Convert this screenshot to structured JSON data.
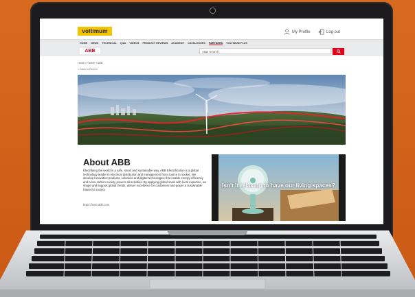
{
  "header": {
    "logo_text": "voltimum",
    "profile_label": "My Profile",
    "logout_label": "Log out"
  },
  "nav": {
    "items": [
      "HOME",
      "NEWS",
      "TECHNICAL",
      "Q&A",
      "VIDEOS",
      "PRODUCT REVIEWS",
      "ACADEMY",
      "CATALOGUES",
      "PARTNERS",
      "VOLTIMUM PLUS"
    ],
    "active": "PARTNERS"
  },
  "subbar": {
    "brand_logo_text": "ABB",
    "search_placeholder": "ABB Search"
  },
  "breadcrumb": {
    "text": "Home / Partner / ABB",
    "back_label": "< Back to Partner"
  },
  "about": {
    "title": "About ABB",
    "body": "Electrifying the world in a safe, smart and sustainable way, ABB Electrification is a global technology leader in electrical distribution and management from source to socket. We develop innovative products, solutions and digital technologies that enable energy-efficiency and a low carbon society powers all activities. By applying global scale with local expertise, we shape and support global trends, deliver excellence for customers and power a sustainable future for society.",
    "url": "https://new.abb.com"
  },
  "video": {
    "caption": "Isn't it relaxing to have our living spaces?"
  },
  "colors": {
    "background": "#d6621b",
    "brand_yellow": "#f4c300",
    "abb_red": "#e3001b"
  }
}
